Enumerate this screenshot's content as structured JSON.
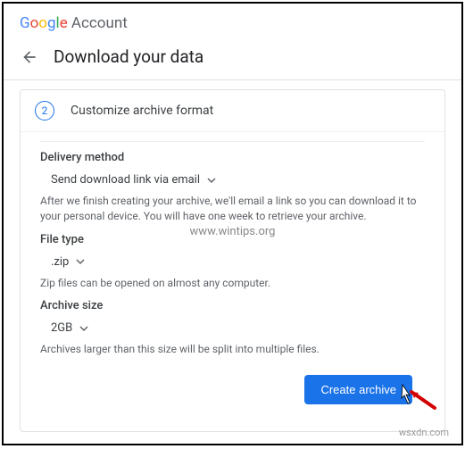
{
  "header": {
    "logo_account": "Account",
    "page_title": "Download your data"
  },
  "step": {
    "number": "2",
    "title": "Customize archive format"
  },
  "delivery": {
    "label": "Delivery method",
    "value": "Send download link via email",
    "desc": "After we finish creating your archive, we'll email a link so you can download it to your personal device. You will have one week to retrieve your archive."
  },
  "filetype": {
    "label": "File type",
    "value": ".zip",
    "desc": "Zip files can be opened on almost any computer."
  },
  "archivesize": {
    "label": "Archive size",
    "value": "2GB",
    "desc": "Archives larger than this size will be split into multiple files."
  },
  "actions": {
    "create": "Create archive"
  },
  "watermark": "www.wintips.org",
  "site": "wsxdn.com"
}
